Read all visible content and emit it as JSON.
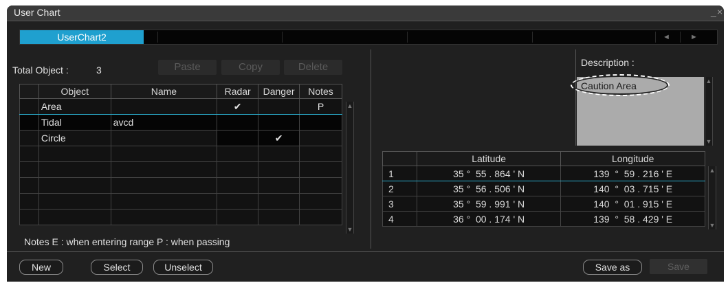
{
  "window": {
    "title": "User Chart",
    "minimize": "_",
    "close": "×"
  },
  "tabs": [
    {
      "label": "UserChart2"
    }
  ],
  "tab_arrows": {
    "prev": "◄",
    "next": "►"
  },
  "objects": {
    "total_label": "Total Object :",
    "total_count": "3",
    "buttons": {
      "paste": "Paste",
      "copy": "Copy",
      "delete": "Delete"
    },
    "columns": [
      "",
      "Object",
      "Name",
      "Radar",
      "Danger",
      "Notes"
    ],
    "rows": [
      {
        "object": "Area",
        "name": "",
        "radar": "✔",
        "danger": "",
        "notes": "P"
      },
      {
        "object": "Tidal",
        "name": "avcd",
        "radar": "",
        "danger": "",
        "notes": ""
      },
      {
        "object": "Circle",
        "name": "",
        "radar": "",
        "danger": "✔",
        "notes": ""
      }
    ],
    "notes_legend": "Notes  E : when entering range  P : when passing"
  },
  "description": {
    "label": "Description :",
    "value": "Caution Area"
  },
  "coordinates": {
    "columns": [
      "",
      "Latitude",
      "Longitude"
    ],
    "rows": [
      {
        "index": "1",
        "lat": "35 °  55 . 864 ' N",
        "lon": "139  °  59 . 216 ' E"
      },
      {
        "index": "2",
        "lat": "35 °  56 . 506 ' N",
        "lon": "140  °  03 . 715 ' E"
      },
      {
        "index": "3",
        "lat": "35 °  59 . 991 ' N",
        "lon": "140  °  01 . 915 ' E"
      },
      {
        "index": "4",
        "lat": "36 °  00 . 174 ' N",
        "lon": "139  °  58 . 429 ' E"
      }
    ]
  },
  "footer": {
    "new": "New",
    "select": "Select",
    "unselect": "Unselect",
    "save_as": "Save as",
    "save": "Save"
  },
  "colors": {
    "accent": "#1fa0cf",
    "selection": "#2bb0d0",
    "window_bg": "#202020",
    "description_bg": "#ababab"
  }
}
